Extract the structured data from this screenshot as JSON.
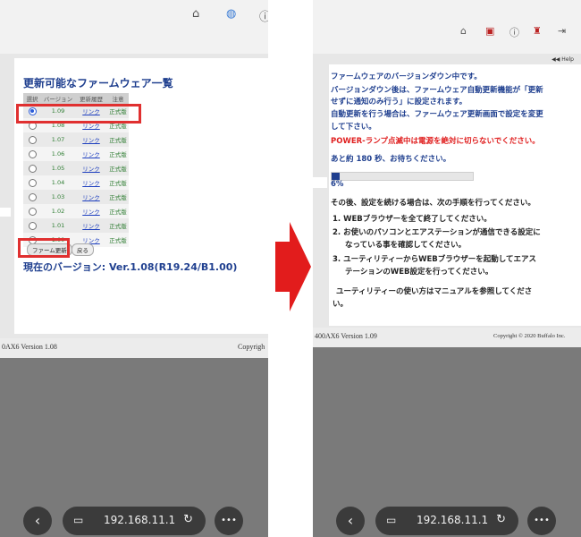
{
  "left": {
    "title": "更新可能なファームウェア一覧",
    "columns": [
      "選択",
      "バージョン",
      "更新履歴",
      "注意"
    ],
    "rows": [
      {
        "version": "1.09",
        "link": "リンク",
        "note": "正式版"
      },
      {
        "version": "1.08",
        "link": "リンク",
        "note": "正式版"
      },
      {
        "version": "1.07",
        "link": "リンク",
        "note": "正式版"
      },
      {
        "version": "1.06",
        "link": "リンク",
        "note": "正式版"
      },
      {
        "version": "1.05",
        "link": "リンク",
        "note": "正式版"
      },
      {
        "version": "1.04",
        "link": "リンク",
        "note": "正式版"
      },
      {
        "version": "1.03",
        "link": "リンク",
        "note": "正式版"
      },
      {
        "version": "1.02",
        "link": "リンク",
        "note": "正式版"
      },
      {
        "version": "1.01",
        "link": "リンク",
        "note": "正式版"
      },
      {
        "version": "1.00",
        "link": "リンク",
        "note": "正式版"
      }
    ],
    "selected_index": 0,
    "update_button": "ファーム更新",
    "back_button": "戻る",
    "current_version": "現在のバージョン: Ver.1.08(R19.24/B1.00)",
    "footer_left": "0AX6 Version 1.08",
    "footer_right": "Copyrigh"
  },
  "right": {
    "help": "◀◀ Help",
    "msg1": "ファームウェアのバージョンダウン中です。",
    "msg2": "バージョンダウン後は、ファームウェア自動更新機能が「更新",
    "msg3": "せずに通知のみ行う」に設定されます。",
    "msg4": "自動更新を行う場合は、ファームウェア更新画面で設定を変更",
    "msg5": "して下さい。",
    "warning": "POWER-ランプ点滅中は電源を絶対に切らないでください。",
    "wait": "あと約 180 秒、お待ちください。",
    "progress_percent": 6,
    "progress_label": "6%",
    "steps_intro": "その後、設定を続ける場合は、次の手順を行ってください。",
    "step1": "1.  WEBブラウザーを全て終了してください。",
    "step2a": "2.  お使いのパソコンとエアステーションが通信できる設定に",
    "step2b": "なっている事を確認してください。",
    "step3a": "3.  ユーティリティーからWEBブラウザーを起動してエアス",
    "step3b": "テーションのWEB設定を行ってください。",
    "utility_note": "ユーティリティーの使い方はマニュアルを参照してくださ",
    "utility_note2": "い。",
    "footer_left": "400AX6 Version 1.09",
    "footer_right": "Copyright © 2020 Buffalo Inc."
  },
  "browser": {
    "url": "192.168.11.1",
    "back_icon": "‹",
    "page_icon": "▭",
    "reload_icon": "↻",
    "more_icon": "•••"
  },
  "colors": {
    "accent_blue": "#1f3f8f",
    "highlight_red": "#e03030",
    "version_green": "#2e7d32"
  }
}
